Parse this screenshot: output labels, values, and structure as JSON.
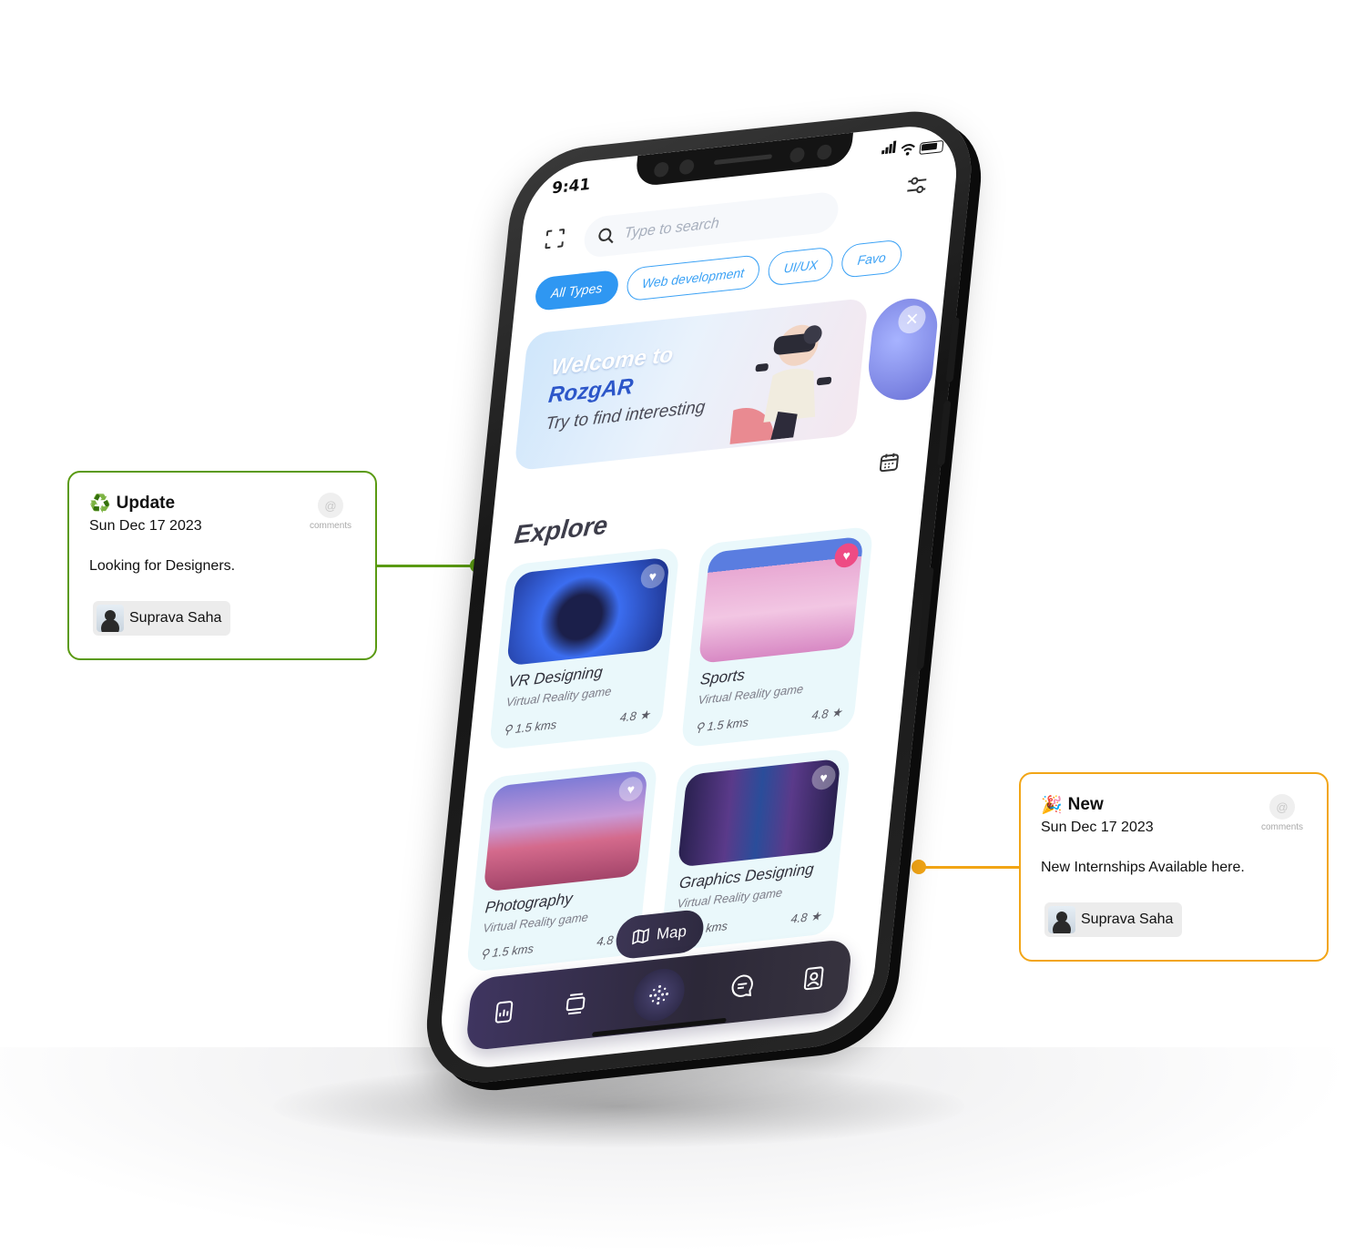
{
  "phone": {
    "time": "9:41",
    "search": {
      "placeholder": "Type to search"
    },
    "chips": [
      "All Types",
      "Web development",
      "UI/UX",
      "Favo"
    ],
    "banner": {
      "line1": "Welcome to",
      "line2": "RozgAR",
      "line3": "Try to find interesting"
    },
    "section_title": "Explore",
    "cards": [
      {
        "title": "VR Designing",
        "subtitle": "Virtual Reality game",
        "distance": "1.5 kms",
        "rating": "4.8 ★"
      },
      {
        "title": "Sports",
        "subtitle": "Virtual Reality game",
        "distance": "1.5 kms",
        "rating": "4.8 ★"
      },
      {
        "title": "Photography",
        "subtitle": "Virtual Reality game",
        "distance": "1.5 kms",
        "rating": "4.8 ★"
      },
      {
        "title": "Graphics Designing",
        "subtitle": "Virtual Reality game",
        "distance": "1.5 kms",
        "rating": "4.8 ★"
      }
    ],
    "map_label": "Map",
    "tabbar_icons": [
      "report-icon",
      "cards-icon",
      "ar-center-icon",
      "chat-icon",
      "profile-icon"
    ]
  },
  "notes": [
    {
      "emoji": "♻️",
      "title": "Update",
      "date": "Sun Dec 17 2023",
      "body": "Looking for Designers.",
      "user": "Suprava Saha",
      "comments_label": "comments",
      "color": "#5a9a12"
    },
    {
      "emoji": "🎉",
      "title": "New",
      "date": "Sun Dec 17 2023",
      "body": "New Internships Available here.",
      "user": "Suprava Saha",
      "comments_label": "comments",
      "color": "#f2a516"
    }
  ],
  "colors": {
    "accent": "#2f97f2",
    "tabbar": "#2c2838",
    "green": "#5a9a12",
    "orange": "#f2a516"
  }
}
